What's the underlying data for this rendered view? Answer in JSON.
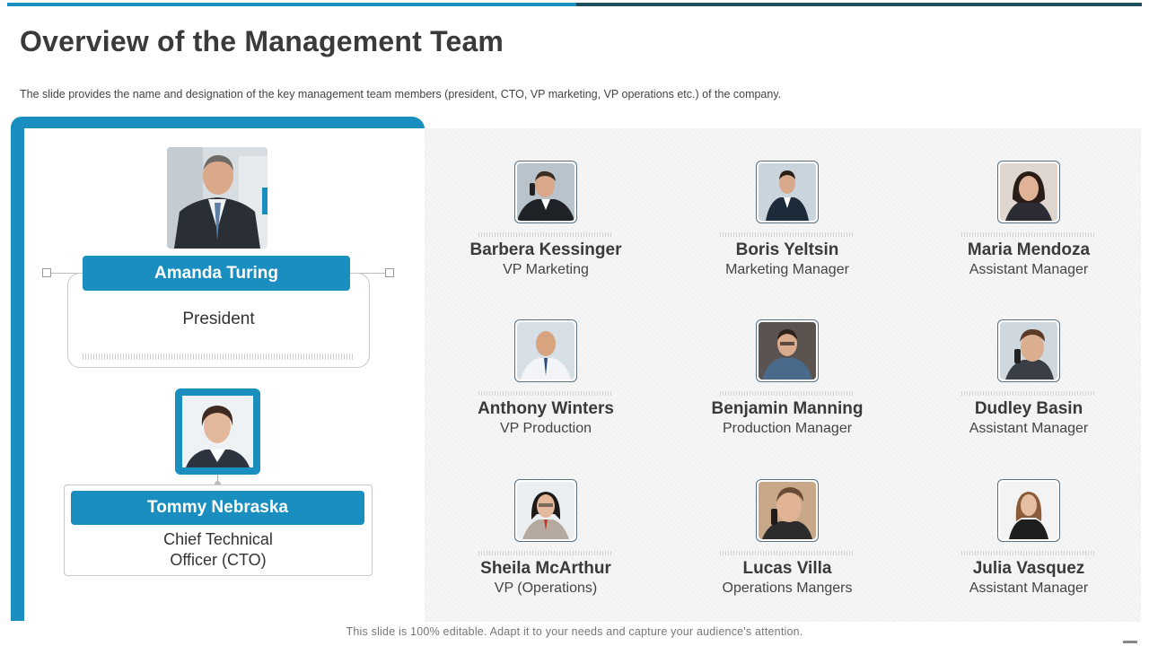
{
  "title": "Overview of the Management Team",
  "subtitle": "The slide provides  the name and designation of the key management team members (president,  CTO, VP marketing, VP operations etc.) of the company.",
  "colors": {
    "accent": "#1a8fbf",
    "dark_teal": "#1c4f5c",
    "pattern_bg": "#f2f2f2"
  },
  "president": {
    "name": "Amanda Turing",
    "role": "President"
  },
  "cto": {
    "name": "Tommy Nebraska",
    "role_line1": "Chief Technical",
    "role_line2": "Officer (CTO)"
  },
  "team": [
    {
      "name": "Barbera Kessinger",
      "role": "VP Marketing"
    },
    {
      "name": "Boris Yeltsin",
      "role": "Marketing Manager"
    },
    {
      "name": "Maria Mendoza",
      "role": "Assistant Manager"
    },
    {
      "name": "Anthony Winters",
      "role": "VP Production"
    },
    {
      "name": "Benjamin Manning",
      "role": "Production Manager"
    },
    {
      "name": "Dudley Basin",
      "role": "Assistant Manager"
    },
    {
      "name": "Sheila McArthur",
      "role": "VP (Operations)"
    },
    {
      "name": "Lucas Villa",
      "role": "Operations Mangers"
    },
    {
      "name": "Julia Vasquez",
      "role": "Assistant Manager"
    }
  ],
  "footer": "This slide is 100% editable. Adapt it to your needs and capture your audience's attention."
}
